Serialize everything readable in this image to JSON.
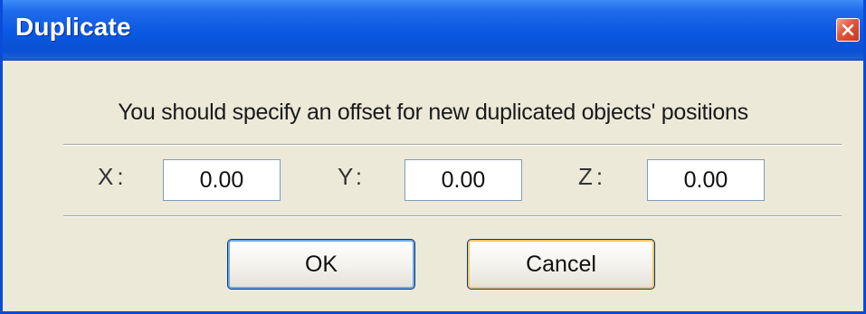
{
  "window": {
    "title": "Duplicate",
    "close_icon": "close-icon"
  },
  "prompt": "You should specify an offset for new duplicated objects' positions",
  "offset": {
    "x": {
      "label": "X:",
      "value": "0.00"
    },
    "y": {
      "label": "Y:",
      "value": "0.00"
    },
    "z": {
      "label": "Z:",
      "value": "0.00"
    }
  },
  "buttons": {
    "ok": "OK",
    "cancel": "Cancel"
  },
  "colors": {
    "titlebar": "#0A58E2",
    "dialog_bg": "#ECE9D8",
    "close_button": "#E0553A"
  }
}
